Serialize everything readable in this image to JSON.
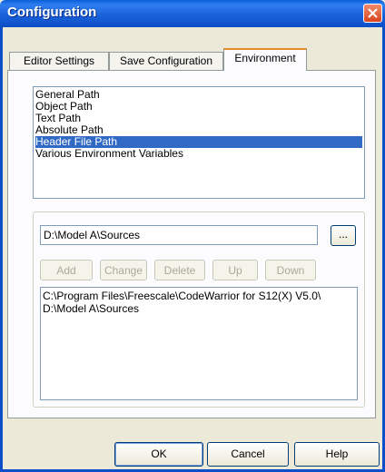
{
  "window": {
    "title": "Configuration"
  },
  "tabs": [
    {
      "label": "Editor Settings",
      "active": false
    },
    {
      "label": "Save Configuration",
      "active": false
    },
    {
      "label": "Environment",
      "active": true
    }
  ],
  "env_list": {
    "items": [
      "General Path",
      "Object Path",
      "Text Path",
      "Absolute Path",
      "Header File Path",
      "Various Environment Variables"
    ],
    "selected_index": 4
  },
  "path_editor": {
    "value": "D:\\Model A\\Sources",
    "browse_label": "...",
    "buttons": {
      "add": "Add",
      "change": "Change",
      "delete": "Delete",
      "up": "Up",
      "down": "Down"
    }
  },
  "path_list": {
    "items": [
      "C:\\Program Files\\Freescale\\CodeWarrior for S12(X) V5.0\\",
      "D:\\Model A\\Sources"
    ]
  },
  "footer": {
    "ok": "OK",
    "cancel": "Cancel",
    "help": "Help"
  },
  "colors": {
    "title_bar": "#0c4fc8",
    "selection": "#316ac5",
    "close": "#d9451d"
  }
}
